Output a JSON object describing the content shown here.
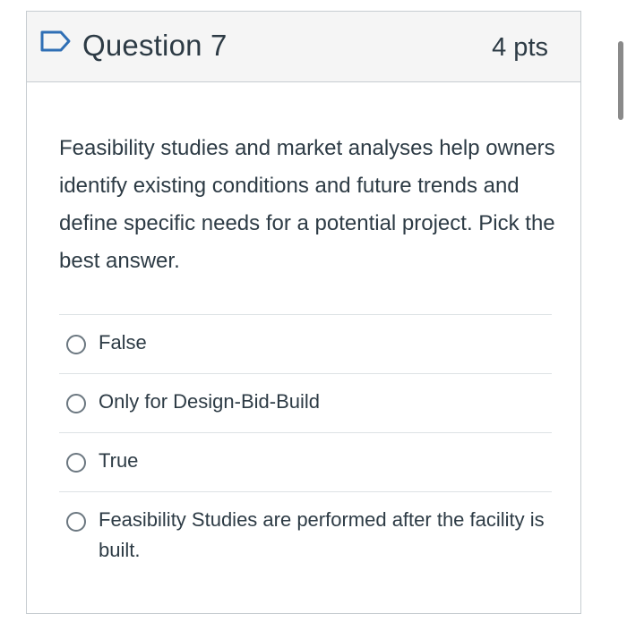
{
  "question": {
    "title": "Question 7",
    "points": "4 pts",
    "text": "Feasibility studies and market analyses help owners identify existing conditions and future trends and define specific needs for a potential project.  Pick the best answer.",
    "flag_icon": "bookmark-flag-icon"
  },
  "answers": [
    {
      "label": "False",
      "selected": false
    },
    {
      "label": "Only for Design-Bid-Build",
      "selected": false
    },
    {
      "label": "True",
      "selected": false
    },
    {
      "label": "Feasibility Studies are performed after the facility is built.",
      "selected": false
    }
  ],
  "colors": {
    "header_bg": "#f5f5f5",
    "border": "#c7cdd1",
    "text": "#2d3b45",
    "flag_blue": "#2f6fb5"
  }
}
